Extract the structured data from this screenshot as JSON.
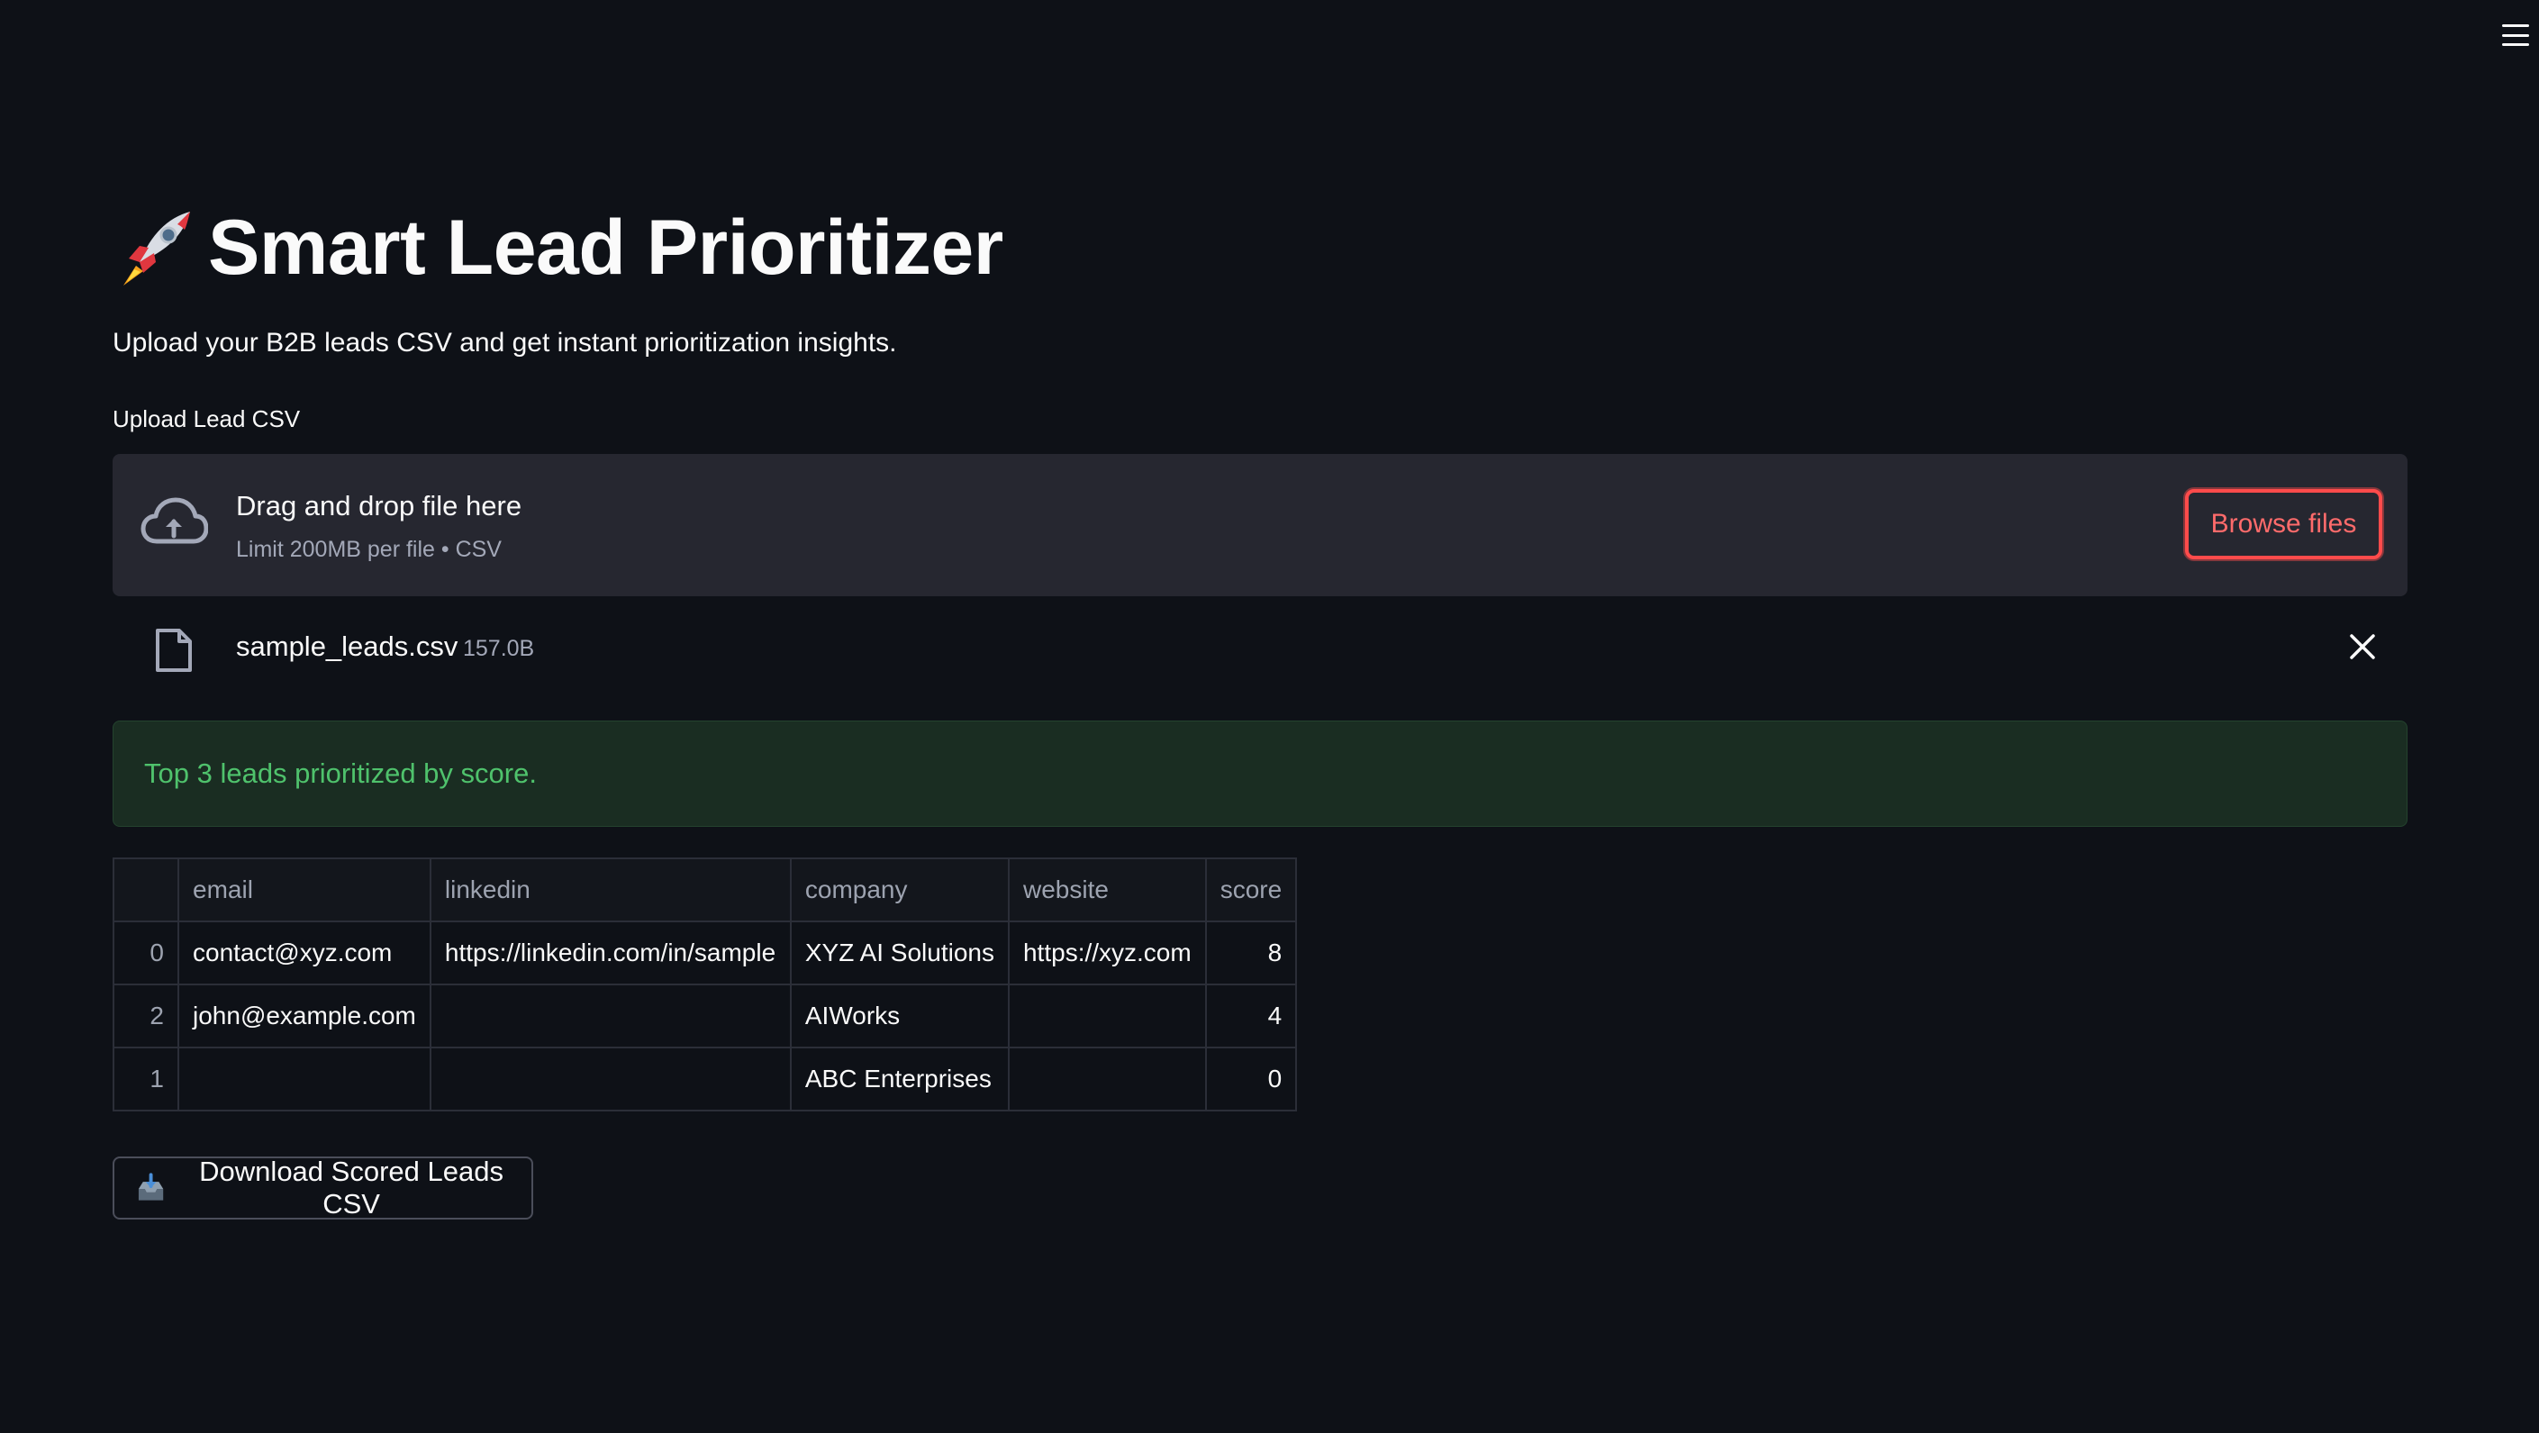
{
  "header": {
    "menu_icon": "hamburger-menu-icon"
  },
  "page": {
    "title_icon": "rocket-icon",
    "title": "Smart Lead Prioritizer",
    "subtitle": "Upload your B2B leads CSV and get instant prioritization insights."
  },
  "uploader": {
    "label": "Upload Lead CSV",
    "dropzone_title": "Drag and drop file here",
    "dropzone_hint": "Limit 200MB per file • CSV",
    "browse_label": "Browse files",
    "cloud_icon": "cloud-upload-icon",
    "accent_color": "#ff4b4b"
  },
  "uploaded_file": {
    "name": "sample_leads.csv",
    "size": "157.0B",
    "file_icon": "file-icon",
    "remove_icon": "close-icon"
  },
  "alert": {
    "message": "Top 3 leads prioritized by score.",
    "color": "#4fc26c"
  },
  "table": {
    "columns": [
      "",
      "email",
      "linkedin",
      "company",
      "website",
      "score"
    ],
    "rows": [
      [
        "0",
        "contact@xyz.com",
        "https://linkedin.com/in/sample",
        "XYZ AI Solutions",
        "https://xyz.com",
        "8"
      ],
      [
        "2",
        "john@example.com",
        "",
        "AIWorks",
        "",
        "4"
      ],
      [
        "1",
        "",
        "",
        "ABC Enterprises",
        "",
        "0"
      ]
    ]
  },
  "download": {
    "icon": "inbox-tray-icon",
    "label": "Download Scored Leads CSV"
  }
}
